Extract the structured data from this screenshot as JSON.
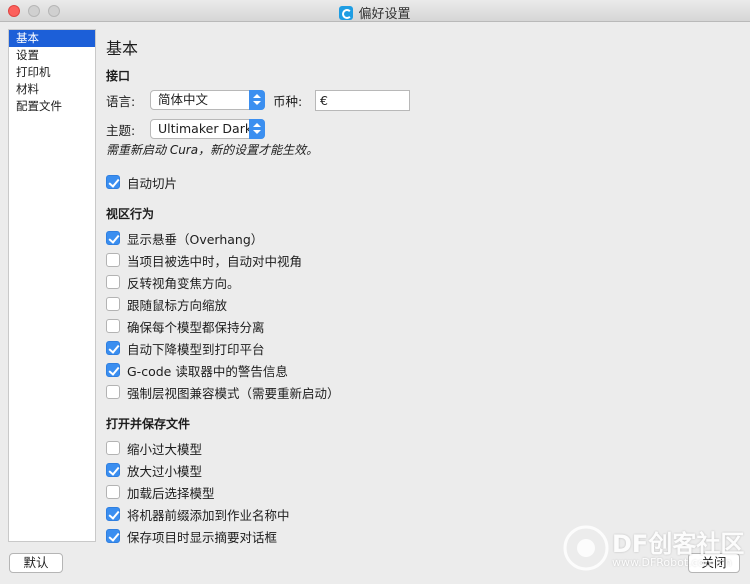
{
  "window": {
    "title": "偏好设置"
  },
  "sidebar": {
    "items": [
      {
        "label": "基本",
        "active": true
      },
      {
        "label": "设置",
        "active": false
      },
      {
        "label": "打印机",
        "active": false
      },
      {
        "label": "材料",
        "active": false
      },
      {
        "label": "配置文件",
        "active": false
      }
    ]
  },
  "main": {
    "title": "基本",
    "interface": {
      "heading": "接口",
      "language_label": "语言:",
      "language_value": "简体中文",
      "currency_label": "币种:",
      "currency_value": "€",
      "theme_label": "主题:",
      "theme_value": "Ultimaker Dark",
      "restart_note": "需重新启动 Cura，新的设置才能生效。"
    },
    "auto_slice": {
      "label": "自动切片",
      "checked": true
    },
    "viewport": {
      "heading": "视区行为",
      "items": [
        {
          "label": "显示悬垂（Overhang）",
          "checked": true
        },
        {
          "label": "当项目被选中时，自动对中视角",
          "checked": false
        },
        {
          "label": "反转视角变焦方向。",
          "checked": false
        },
        {
          "label": "跟随鼠标方向缩放",
          "checked": false
        },
        {
          "label": "确保每个模型都保持分离",
          "checked": false
        },
        {
          "label": "自动下降模型到打印平台",
          "checked": true
        },
        {
          "label": "G-code 读取器中的警告信息",
          "checked": true
        },
        {
          "label": "强制层视图兼容模式（需要重新启动）",
          "checked": false
        }
      ]
    },
    "files": {
      "heading": "打开并保存文件",
      "items": [
        {
          "label": "缩小过大模型",
          "checked": false
        },
        {
          "label": "放大过小模型",
          "checked": true
        },
        {
          "label": "加载后选择模型",
          "checked": false
        },
        {
          "label": "将机器前缀添加到作业名称中",
          "checked": true
        },
        {
          "label": "保存项目时显示摘要对话框",
          "checked": true
        }
      ]
    }
  },
  "footer": {
    "defaults_label": "默认",
    "close_label": "关闭"
  },
  "watermark": {
    "brand": "DF创客社区",
    "url": "www.DFRobot.com.cn"
  },
  "colors": {
    "accent": "#3a8ef0",
    "selection": "#1c5fd8",
    "close": "#fc605c"
  }
}
